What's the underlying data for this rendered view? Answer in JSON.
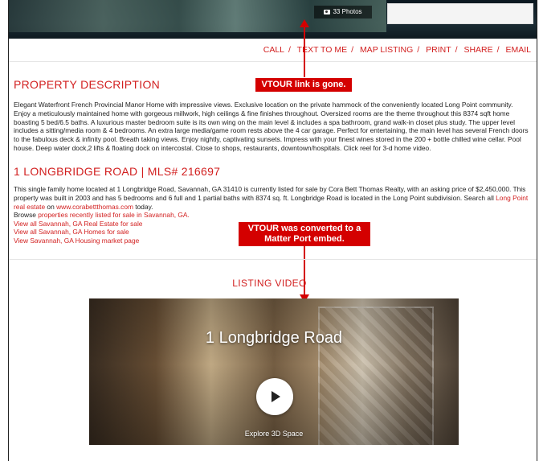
{
  "hero": {
    "photos_badge": "33 Photos"
  },
  "actions": [
    "CALL",
    "TEXT TO ME",
    "MAP LISTING",
    "PRINT",
    "SHARE",
    "EMAIL"
  ],
  "annotations": {
    "vtour_gone": "VTOUR link is gone.",
    "vtour_converted": "VTOUR was converted to a Matter Port embed."
  },
  "description": {
    "heading": "PROPERTY DESCRIPTION",
    "text": "Elegant Waterfront French Provincial Manor Home with impressive views. Exclusive location on the private hammock of the conveniently located Long Point community. Enjoy a meticulously maintained home with gorgeous millwork, high ceilings & fine finishes throughout. Oversized rooms are the theme throughout this 8374 sqft home boasting 5 bed/6.5 baths. A luxurious master bedroom suite is its own wing on the main level & includes a spa bathroom, grand walk-in closet plus study. The upper level includes a sitting/media room & 4 bedrooms. An extra large media/game room rests above the 4 car garage. Perfect for entertaining, the main level has several French doors to the fabulous deck & infinity pool. Breath taking views. Enjoy nightly, captivating sunsets. Impress with your finest wines stored in the 200 + bottle chilled wine cellar. Pool house. Deep water dock,2 lifts & floating dock on intercostal. Close to shops, restaurants, downtown/hospitals. Click reel for 3-d home video."
  },
  "listing": {
    "heading": "1 LONGBRIDGE ROAD | MLS# 216697",
    "text_part1": "This single family home located at 1 Longbridge Road, Savannah, GA 31410 is currently listed for sale by Cora Bett Thomas Realty, with an asking price of $2,450,000. This property was built in 2003 and has 5 bedrooms and 6 full and 1 partial baths with 8374 sq. ft. Longbridge Road is located in the Long Point subdivision. Search all ",
    "link_long_point": "Long Point real estate",
    "text_on": " on ",
    "link_site": "www.corabettthomas.com",
    "text_today": " today.",
    "browse_prefix": "Browse ",
    "link_recent": "properties recently listed for sale in Savannah, GA.",
    "links": [
      "View all Savannah, GA Real Estate for sale",
      "View all Savannah, GA Homes for sale",
      "View Savannah, GA Housing market page"
    ]
  },
  "video": {
    "section_title": "LISTING VIDEO",
    "name": "1 Longbridge Road",
    "explore": "Explore 3D Space"
  }
}
